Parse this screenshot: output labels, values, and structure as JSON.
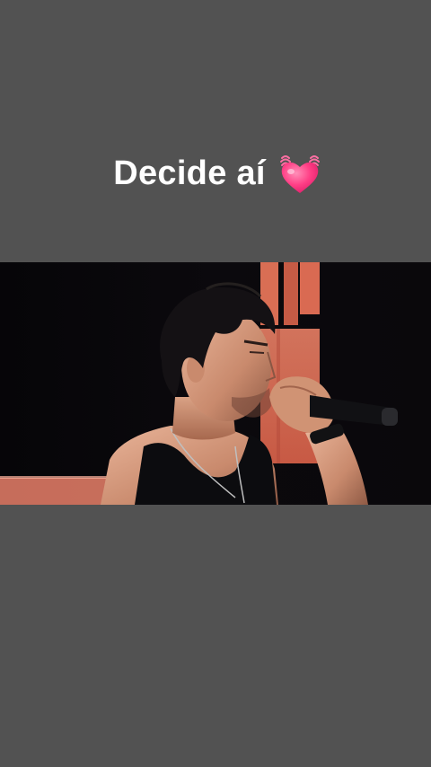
{
  "story": {
    "caption": "Decide aí",
    "caption_emoji": "beating-heart-icon",
    "background_color": "#525252",
    "caption_color": "#ffffff"
  },
  "video": {
    "description_icon": "singer-with-microphone-photo",
    "accent_color": "#f07a5c"
  }
}
